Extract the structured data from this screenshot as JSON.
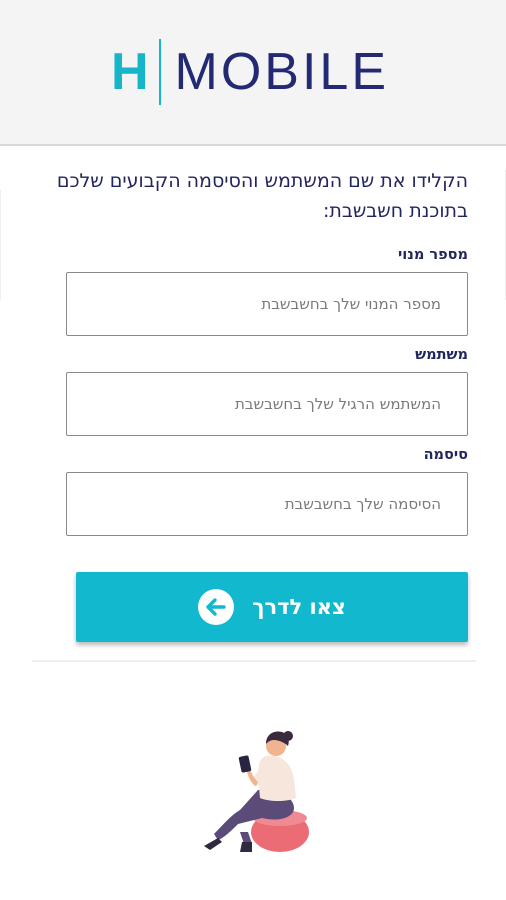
{
  "header": {
    "logo_left": "H",
    "logo_right": "MOBILE",
    "brand_colors": {
      "teal": "#14b6c8",
      "navy": "#232a73"
    }
  },
  "form": {
    "instructions": "הקלידו את שם המשתמש והסיסמה הקבועים שלכם בתוכנת חשבשבת:",
    "fields": [
      {
        "label": "מספר מנוי",
        "placeholder": "מספר המנוי שלך בחשבשבת"
      },
      {
        "label": "משתמש",
        "placeholder": "המשתמש הרגיל שלך בחשבשבת"
      },
      {
        "label": "סיסמה",
        "placeholder": "הסיסמה שלך בחשבשבת"
      }
    ],
    "submit_label": "צאו לדרך",
    "submit_icon": "arrow-left-circle-icon",
    "submit_color": "#11b8ce"
  },
  "illustration": {
    "icon": "woman-sitting-with-phone-illustration"
  }
}
